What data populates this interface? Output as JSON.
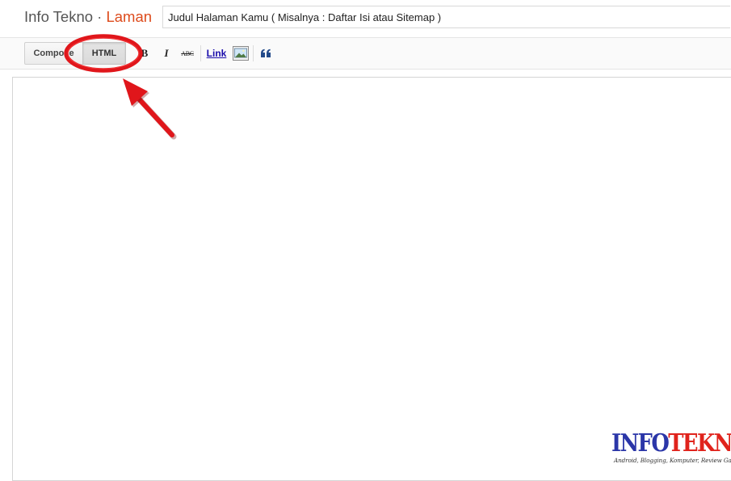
{
  "header": {
    "blog_name": "Info Tekno",
    "separator": "·",
    "section": "Laman",
    "title_input_value": "Judul Halaman Kamu ( Misalnya : Daftar Isi atau Sitemap )"
  },
  "toolbar": {
    "compose_label": "Compose",
    "html_label": "HTML",
    "bold_label": "B",
    "italic_label": "I",
    "strike_label": "ABC",
    "link_label": "Link"
  },
  "icons": {
    "image": "image-icon",
    "quote": "quote-icon",
    "annotation": "red-circle-and-arrow"
  },
  "colors": {
    "section_accent": "#dd4b1c",
    "annotation_red": "#e0161b",
    "logo_blue": "#2b36a8",
    "logo_red": "#e0231c"
  },
  "watermark": {
    "part1": "INFO",
    "part2": "TEKNO",
    "tagline": "Android, Blogging, Komputer, Review Gadget"
  }
}
